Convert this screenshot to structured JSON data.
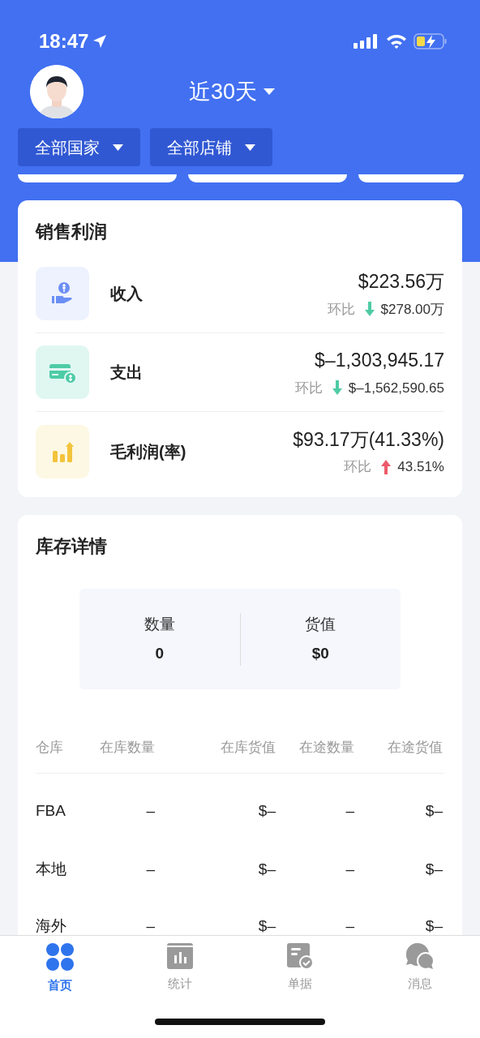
{
  "status_bar": {
    "time": "18:47"
  },
  "header": {
    "title": "近30天",
    "filters": [
      {
        "label": "全部国家"
      },
      {
        "label": "全部店铺"
      }
    ]
  },
  "sales": {
    "title": "销售利润",
    "rows": [
      {
        "kind": "income",
        "label": "收入",
        "value": "$223.56万",
        "comparison": {
          "label": "环比",
          "kind": "down",
          "value": "$278.00万"
        }
      },
      {
        "kind": "expense",
        "label": "支出",
        "value": "$–1,303,945.17",
        "comparison": {
          "label": "环比",
          "kind": "down",
          "value": "$–1,562,590.65"
        }
      },
      {
        "kind": "profit",
        "label": "毛利润(率)",
        "value": "$93.17万(41.33%)",
        "comparison": {
          "label": "环比",
          "kind": "up",
          "value": "43.51%"
        }
      }
    ]
  },
  "inventory": {
    "title": "库存详情",
    "summary": [
      {
        "label": "数量",
        "value": "0"
      },
      {
        "label": "货值",
        "value": "$0"
      }
    ],
    "table": {
      "columns": [
        "仓库",
        "在库数量",
        "在库货值",
        "在途数量",
        "在途货值"
      ],
      "rows": [
        [
          "FBA",
          "–",
          "$–",
          "–",
          "$–"
        ],
        [
          "本地",
          "–",
          "$–",
          "–",
          "$–"
        ],
        [
          "海外",
          "–",
          "$–",
          "–",
          "$–"
        ]
      ]
    }
  },
  "tab_bar": [
    {
      "label": "首页",
      "kind": "home",
      "selected": true
    },
    {
      "label": "统计",
      "kind": "stats",
      "selected": false
    },
    {
      "label": "单据",
      "kind": "docs",
      "selected": false
    },
    {
      "label": "消息",
      "kind": "messages",
      "selected": false
    }
  ]
}
